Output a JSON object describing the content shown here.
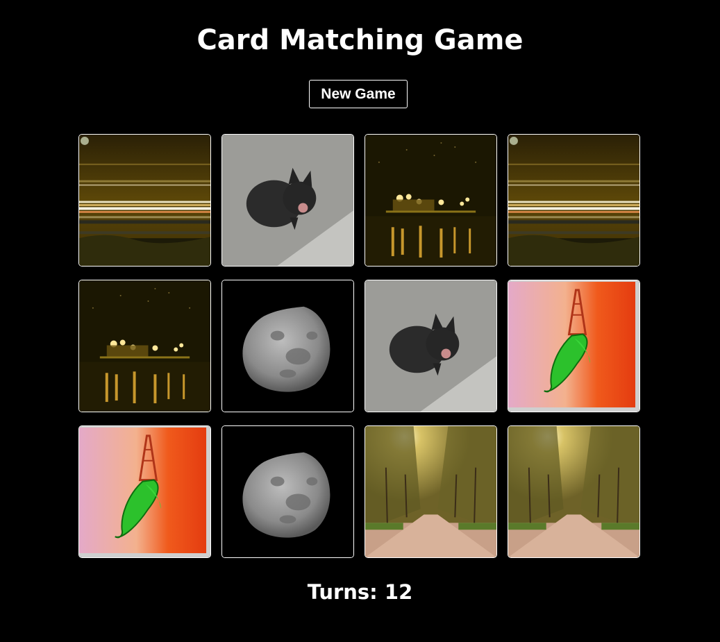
{
  "game": {
    "title": "Card Matching Game",
    "new_game_label": "New Game",
    "turns_label": "Turns:",
    "turns": 12
  },
  "cards": [
    {
      "image": "highway-light-trails-night",
      "face_up": true
    },
    {
      "image": "black-kitten-on-concrete",
      "face_up": true
    },
    {
      "image": "harbor-lights-night",
      "face_up": true
    },
    {
      "image": "highway-light-trails-night",
      "face_up": true
    },
    {
      "image": "harbor-lights-night",
      "face_up": true
    },
    {
      "image": "moon",
      "face_up": true
    },
    {
      "image": "black-kitten-on-concrete",
      "face_up": true
    },
    {
      "image": "eiffel-tower-chili-painting",
      "face_up": true
    },
    {
      "image": "eiffel-tower-chili-painting",
      "face_up": true
    },
    {
      "image": "moon",
      "face_up": true
    },
    {
      "image": "tree-lined-park-avenue",
      "face_up": true
    },
    {
      "image": "tree-lined-park-avenue",
      "face_up": true
    }
  ]
}
